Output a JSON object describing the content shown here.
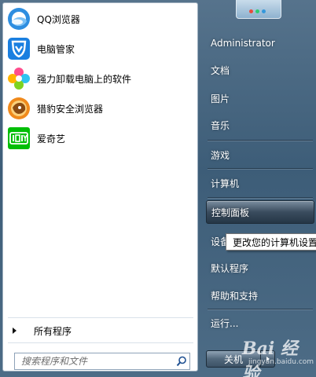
{
  "left_pane": {
    "programs": [
      {
        "label": "QQ浏览器",
        "icon": "qq-browser-icon"
      },
      {
        "label": "电脑管家",
        "icon": "pc-manager-icon"
      },
      {
        "label": "强力卸载电脑上的软件",
        "icon": "uninstaller-icon"
      },
      {
        "label": "猎豹安全浏览器",
        "icon": "cheetah-browser-icon"
      },
      {
        "label": "爱奇艺",
        "icon": "iqiyi-icon"
      }
    ],
    "all_programs_label": "所有程序",
    "search": {
      "placeholder": "搜索程序和文件",
      "value": ""
    }
  },
  "right_pane": {
    "items": [
      {
        "label": "Administrator"
      },
      {
        "label": "文档"
      },
      {
        "label": "图片"
      },
      {
        "label": "音乐"
      },
      {
        "label": "游戏"
      },
      {
        "label": "计算机"
      },
      {
        "label": "控制面板",
        "selected": true
      },
      {
        "label": "设备"
      },
      {
        "label": "默认程序"
      },
      {
        "label": "帮助和支持"
      },
      {
        "label": "运行..."
      }
    ],
    "tooltip": "更改您的计算机设置",
    "shutdown_label": "关机"
  },
  "watermark": {
    "brand": "Bai 经验",
    "url": "jingyan.baidu.com"
  },
  "colors": {
    "selected_bg": "#3a4c5e",
    "qq_blue": "#2e8ee0",
    "pcmgr_blue": "#1a7fe0",
    "cheetah_orange": "#f08a1c",
    "iqiyi_green": "#00be06"
  }
}
